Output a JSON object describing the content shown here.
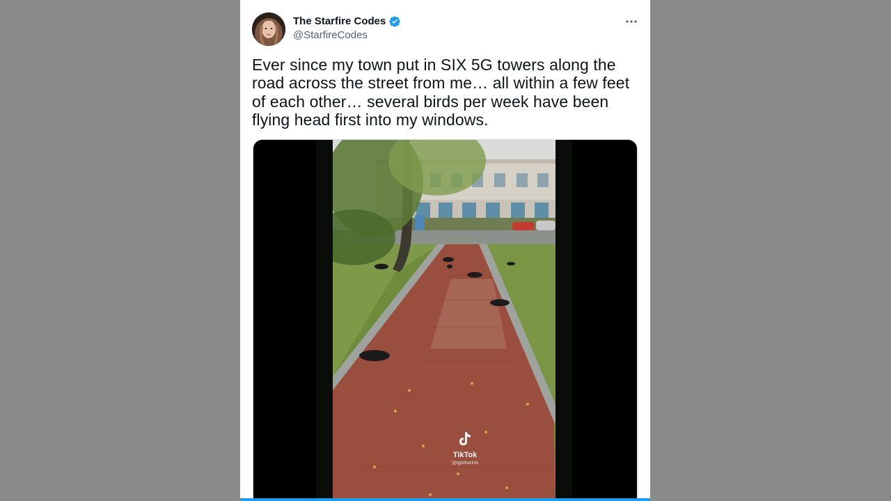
{
  "tweet": {
    "author": {
      "display_name": "The Starfire Codes",
      "handle": "@StarfireCodes",
      "verified": true,
      "avatar": "profile-photo"
    },
    "text": "Ever since my town put in SIX 5G towers along the road across the street from me… all within a few feet of each other… several birds per week have been flying head first into my windows.",
    "more_icon": "ellipsis-icon",
    "media": {
      "type": "video",
      "watermark": {
        "brand": "TikTok",
        "username": "@igorkarina"
      }
    }
  },
  "colors": {
    "background": "#8a8a8a",
    "card": "#ffffff",
    "text": "#0f1419",
    "secondary_text": "#536471",
    "verified": "#1d9bf0",
    "accent_bar": "#1d9bf0"
  }
}
